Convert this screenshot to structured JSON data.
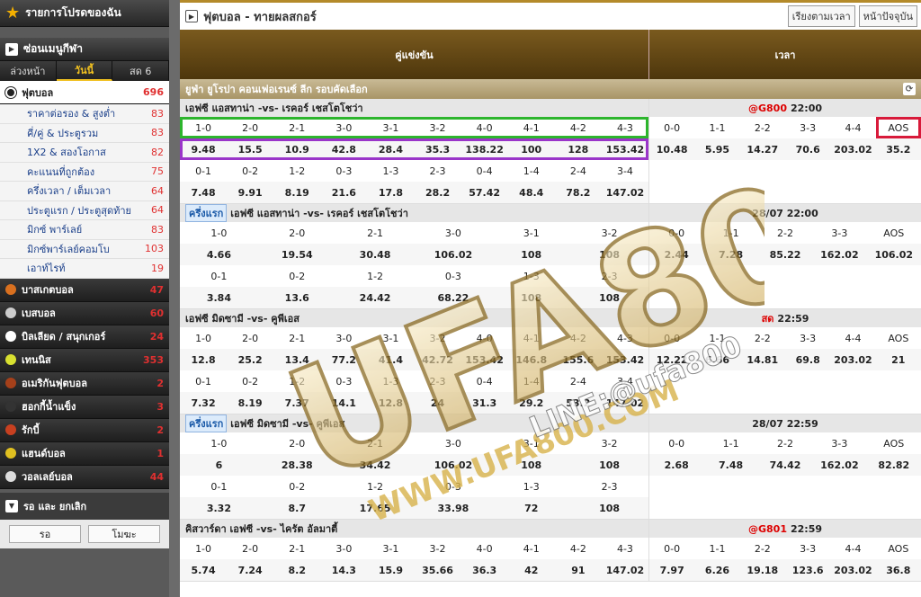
{
  "sidebar": {
    "favorites": "รายการโปรดของฉัน",
    "hide_menu": "ซ่อนเมนูกีฬา",
    "tabs": [
      "ล่วงหน้า",
      "วันนี้",
      "สด 6"
    ],
    "soccer": {
      "label": "ฟุตบอล",
      "count": "696"
    },
    "soccer_items": [
      {
        "label": "ราคาต่อรอง & สูงต่ำ",
        "count": "83"
      },
      {
        "label": "คี่/คู่ & ประตูรวม",
        "count": "83"
      },
      {
        "label": "1X2 & สองโอกาส",
        "count": "82"
      },
      {
        "label": "คะแนนที่ถูกต้อง",
        "count": "75"
      },
      {
        "label": "ครึ่งเวลา / เต็มเวลา",
        "count": "64"
      },
      {
        "label": "ประตูแรก / ประตูสุดท้าย",
        "count": "64"
      },
      {
        "label": "มิกซ์ พาร์เลย์",
        "count": "83"
      },
      {
        "label": "มิกซ์พาร์เลย์คอมโบ",
        "count": "103"
      },
      {
        "label": "เอาท์ไรท์",
        "count": "19"
      }
    ],
    "sports": [
      {
        "label": "บาสเกตบอล",
        "count": "47",
        "color": "#d9701f"
      },
      {
        "label": "เบสบอล",
        "count": "60",
        "color": "#cccccc"
      },
      {
        "label": "บิลเลียด / สนุกเกอร์",
        "count": "24",
        "color": "#ffffff"
      },
      {
        "label": "เทนนิส",
        "count": "353",
        "color": "#d8e030"
      },
      {
        "label": "อเมริกันฟุตบอล",
        "count": "2",
        "color": "#a5401a"
      },
      {
        "label": "ฮอกกี้น้ำแข็ง",
        "count": "3",
        "color": "#333333"
      },
      {
        "label": "รักบี้",
        "count": "2",
        "color": "#c84020"
      },
      {
        "label": "แฮนด์บอล",
        "count": "1",
        "color": "#e0c020"
      },
      {
        "label": "วอลเลย์บอล",
        "count": "44",
        "color": "#dddddd"
      }
    ],
    "waiting": "รอ และ ยกเลิก",
    "btn_wait": "รอ",
    "btn_void": "โมฆะ"
  },
  "main": {
    "title": "ฟุตบอล - ทายผลสกอร์",
    "sort_time": "เรียงตามเวลา",
    "today": "หน้าปัจจุบัน",
    "col_match": "คู่แข่งขัน",
    "col_time": "เวลา",
    "league": "ยูฟ่า ยูโรปา คอนเฟอเรนซ์ ลีก รอบคัดเลือก"
  },
  "matches": [
    {
      "title": "เอฟซี แอสทาน่า  -vs- เรคอร์ เชสโตโชว่า",
      "half": "",
      "time_code": "@G800",
      "time": "22:00",
      "left_rows": [
        [
          "1-0",
          "2-0",
          "2-1",
          "3-0",
          "3-1",
          "3-2",
          "4-0",
          "4-1",
          "4-2",
          "4-3"
        ],
        [
          "9.48",
          "15.5",
          "10.9",
          "42.8",
          "28.4",
          "35.3",
          "138.22",
          "100",
          "128",
          "153.42"
        ],
        [
          "0-1",
          "0-2",
          "1-2",
          "0-3",
          "1-3",
          "2-3",
          "0-4",
          "1-4",
          "2-4",
          "3-4"
        ],
        [
          "7.48",
          "9.91",
          "8.19",
          "21.6",
          "17.8",
          "28.2",
          "57.42",
          "48.4",
          "78.2",
          "147.02"
        ]
      ],
      "right_rows": [
        [
          "0-0",
          "1-1",
          "2-2",
          "3-3",
          "4-4",
          "AOS"
        ],
        [
          "10.48",
          "5.95",
          "14.27",
          "70.6",
          "203.02",
          "35.2"
        ]
      ]
    },
    {
      "title": "เอฟซี แอสทาน่า  -vs- เรคอร์ เชสโตโชว่า",
      "half": "ครึ่งแรก",
      "time_code": "",
      "time": "28/07 22:00",
      "left_rows": [
        [
          "1-0",
          "2-0",
          "2-1",
          "3-0",
          "3-1",
          "3-2"
        ],
        [
          "4.66",
          "19.54",
          "30.48",
          "106.02",
          "108",
          "108"
        ],
        [
          "0-1",
          "0-2",
          "1-2",
          "0-3",
          "1-3",
          "2-3"
        ],
        [
          "3.84",
          "13.6",
          "24.42",
          "68.22",
          "108",
          "108"
        ]
      ],
      "right_rows": [
        [
          "0-0",
          "1-1",
          "2-2",
          "3-3",
          "AOS"
        ],
        [
          "2.44",
          "7.28",
          "85.22",
          "162.02",
          "106.02"
        ]
      ]
    },
    {
      "title": "เอฟซี มิดซามี  -vs- คูพีเอส",
      "half": "",
      "time_code": "สด",
      "time": "22:59",
      "left_rows": [
        [
          "1-0",
          "2-0",
          "2-1",
          "3-0",
          "3-1",
          "3-2",
          "4-0",
          "4-1",
          "4-2",
          "4-3"
        ],
        [
          "12.8",
          "25.2",
          "13.4",
          "77.2",
          "41.4",
          "42.72",
          "153.42",
          "146.8",
          "155.6",
          "153.42"
        ],
        [
          "0-1",
          "0-2",
          "1-2",
          "0-3",
          "1-3",
          "2-3",
          "0-4",
          "1-4",
          "2-4",
          "3-4"
        ],
        [
          "7.32",
          "8.19",
          "7.37",
          "14.1",
          "12.8",
          "24",
          "31.3",
          "29.2",
          "53.2",
          "147.02"
        ]
      ],
      "right_rows": [
        [
          "0-0",
          "1-1",
          "2-2",
          "3-3",
          "4-4",
          "AOS"
        ],
        [
          "12.22",
          "6.66",
          "14.81",
          "69.8",
          "203.02",
          "21"
        ]
      ]
    },
    {
      "title": "เอฟซี มิดซามี  -vs- คูพีเอส",
      "half": "ครึ่งแรก",
      "time_code": "",
      "time": "28/07 22:59",
      "left_rows": [
        [
          "1-0",
          "2-0",
          "2-1",
          "3-0",
          "3-1",
          "3-2"
        ],
        [
          "6",
          "28.38",
          "34.42",
          "106.02",
          "108",
          "108"
        ],
        [
          "0-1",
          "0-2",
          "1-2",
          "0-3",
          "1-3",
          "2-3"
        ],
        [
          "3.32",
          "8.7",
          "17.65",
          "33.98",
          "72",
          "108"
        ]
      ],
      "right_rows": [
        [
          "0-0",
          "1-1",
          "2-2",
          "3-3",
          "AOS"
        ],
        [
          "2.68",
          "7.48",
          "74.42",
          "162.02",
          "82.82"
        ]
      ]
    },
    {
      "title": "คิสวาร์ดา เอฟซี  -vs- ไครัต อัลมาตี้",
      "half": "",
      "time_code": "@G801",
      "time": "22:59",
      "left_rows": [
        [
          "1-0",
          "2-0",
          "2-1",
          "3-0",
          "3-1",
          "3-2",
          "4-0",
          "4-1",
          "4-2",
          "4-3"
        ],
        [
          "5.74",
          "7.24",
          "8.2",
          "14.3",
          "15.9",
          "35.66",
          "36.3",
          "42",
          "91",
          "147.02"
        ]
      ],
      "right_rows": [
        [
          "0-0",
          "1-1",
          "2-2",
          "3-3",
          "4-4",
          "AOS"
        ],
        [
          "7.97",
          "6.26",
          "19.18",
          "123.6",
          "203.02",
          "36.8"
        ]
      ]
    }
  ],
  "watermark": {
    "brand": "UFA800",
    "site": "WWW.UFA800.COM",
    "line": "LINE:@ufa800"
  }
}
